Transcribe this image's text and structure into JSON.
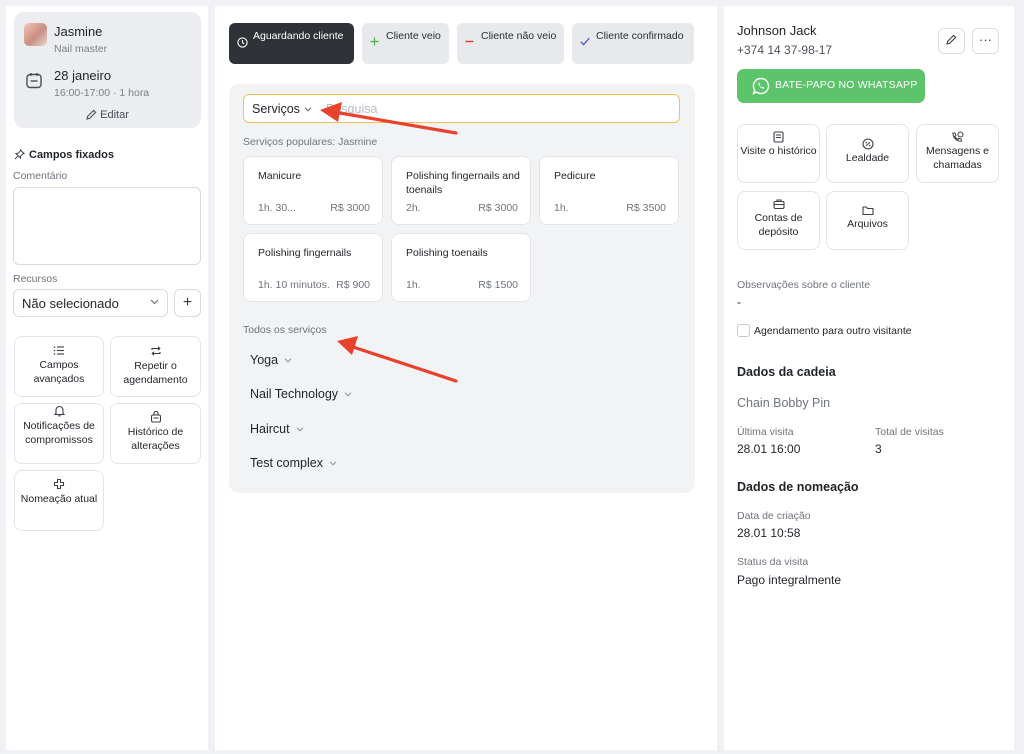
{
  "master": {
    "name": "Jasmine",
    "role": "Nail master",
    "date": "28 janeiro",
    "time": "16:00-17:00 · 1 hora",
    "edit_label": "Editar"
  },
  "pinned": {
    "title": "Campos fixados"
  },
  "comment": {
    "label": "Comentário"
  },
  "resources": {
    "label": "Recursos",
    "value": "Não selecionado",
    "add_label": "+"
  },
  "left_tiles": [
    {
      "icon": "list-icon",
      "label": "Campos avançados"
    },
    {
      "icon": "repeat-icon",
      "label": "Repetir o agendamento"
    },
    {
      "icon": "bell-icon",
      "label": "Notificações de compromissos"
    },
    {
      "icon": "history-icon",
      "label": "Histórico de alterações"
    },
    {
      "icon": "puzzle-icon",
      "label": "Nomeação atual"
    }
  ],
  "status_tabs": [
    {
      "icon": "clock-icon",
      "label": "Aguardando cliente",
      "active": true
    },
    {
      "icon": "plus-icon",
      "label": "Cliente veio",
      "color": "#4caf50"
    },
    {
      "icon": "minus-icon",
      "label": "Cliente não veio",
      "color": "#e53935"
    },
    {
      "icon": "check-icon",
      "label": "Cliente confirmado",
      "color": "#3f51b5"
    }
  ],
  "search": {
    "dropdown_label": "Serviços",
    "placeholder": "Pesquisa"
  },
  "popular": {
    "label": "Serviços populares: Jasmine",
    "services": [
      {
        "name": "Manicure",
        "duration": "1h. 30...",
        "price": "R$ 3000"
      },
      {
        "name": "Polishing fingernails and toenails",
        "duration": "2h.",
        "price": "R$ 3000"
      },
      {
        "name": "Pedicure",
        "duration": "1h.",
        "price": "R$ 3500"
      },
      {
        "name": "Polishing fingernails",
        "duration": "1h. 10 minutos.",
        "price": "R$ 900"
      },
      {
        "name": "Polishing toenails",
        "duration": "1h.",
        "price": "R$ 1500"
      }
    ]
  },
  "all_services": {
    "label": "Todos os serviços",
    "categories": [
      "Yoga",
      "Nail Technology",
      "Haircut",
      "Test complex"
    ]
  },
  "client": {
    "name": "Johnson Jack",
    "phone": "+374 14 37-98-17",
    "edit_icon": "pencil-icon",
    "more_label": "···",
    "whatsapp_label": "BATE-PAPO NO WHATSAPP",
    "whatsapp_color": "#5dc46b"
  },
  "client_tiles": [
    {
      "icon": "document-icon",
      "label": "Visite o histórico"
    },
    {
      "icon": "loyalty-icon",
      "label": "Lealdade"
    },
    {
      "icon": "phone-chat-icon",
      "label": "Mensagens e chamadas"
    },
    {
      "icon": "wallet-icon",
      "label": "Contas de depósito"
    },
    {
      "icon": "folder-icon",
      "label": "Arquivos"
    }
  ],
  "notes": {
    "label": "Observações sobre o cliente",
    "value": "-"
  },
  "other_visitor": {
    "label": "Agendamento para outro visitante"
  },
  "chain": {
    "title": "Dados da cadeia",
    "name": "Chain Bobby Pin",
    "last_visit_label": "Última visita",
    "last_visit_value": "28.01 16:00",
    "total_label": "Total de visitas",
    "total_value": "3"
  },
  "appointment": {
    "title": "Dados de nomeação",
    "created_label": "Data de criação",
    "created_value": "28.01 10:58",
    "status_label": "Status da visita",
    "status_value": "Pago integralmente"
  },
  "colors": {
    "accent_border": "#f1c15b",
    "active_tab": "#2f3338",
    "annotation_arrow": "#e8412c"
  }
}
